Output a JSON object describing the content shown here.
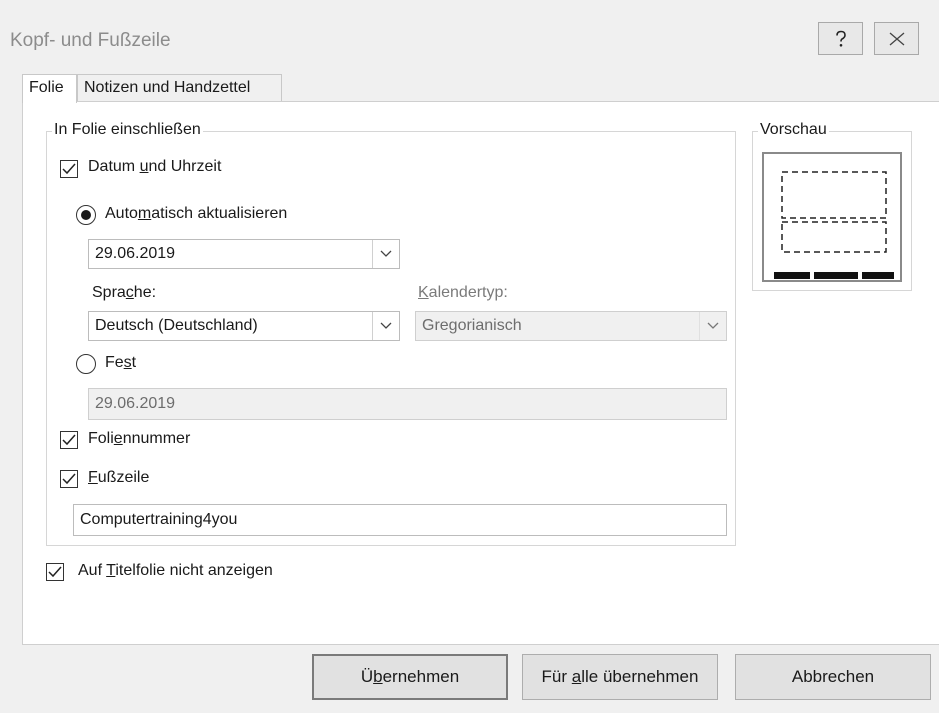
{
  "window": {
    "title": "Kopf- und Fußzeile",
    "help_icon": "question-mark-icon",
    "close_icon": "close-icon"
  },
  "tabs": [
    {
      "label": "Folie",
      "active": true
    },
    {
      "label": "Notizen und Handzettel",
      "active": false
    }
  ],
  "include_group": {
    "legend": "In Folie einschließen",
    "date_time": {
      "pre": "Datum ",
      "u": "u",
      "post": "nd Uhrzeit",
      "checked": true
    },
    "auto_update": {
      "pre": "Auto",
      "u": "m",
      "post": "atisch aktualisieren",
      "selected": true
    },
    "date_value": "29.06.2019",
    "language_label": {
      "pre": "Spra",
      "u": "c",
      "post": "he:"
    },
    "language_value": "Deutsch (Deutschland)",
    "calendar_label": {
      "pre": "",
      "u": "K",
      "post": "alendertyp:"
    },
    "calendar_value": "Gregorianisch",
    "fixed": {
      "pre": "Fe",
      "u": "s",
      "post": "t",
      "selected": false
    },
    "fixed_value": "29.06.2019",
    "slide_number": {
      "pre": "Foli",
      "u": "e",
      "post": "nnummer",
      "checked": true
    },
    "footer": {
      "pre": "",
      "u": "F",
      "post": "ußzeile",
      "checked": true
    },
    "footer_text": "Computertraining4you"
  },
  "hide_title": {
    "pre": "Auf ",
    "u": "T",
    "post": "itelfolie nicht anzeigen",
    "checked": true
  },
  "preview": {
    "legend": "Vorschau"
  },
  "buttons": {
    "apply": {
      "pre": "Ü",
      "u": "b",
      "post": "ernehmen"
    },
    "apply_all": {
      "pre": "Für ",
      "u": "a",
      "post": "lle übernehmen"
    },
    "cancel": {
      "label": "Abbrechen"
    }
  },
  "colors": {
    "dialog_bg": "#f0f0f0",
    "panel_bg": "#ffffff",
    "title_text": "#8c8c8c"
  }
}
